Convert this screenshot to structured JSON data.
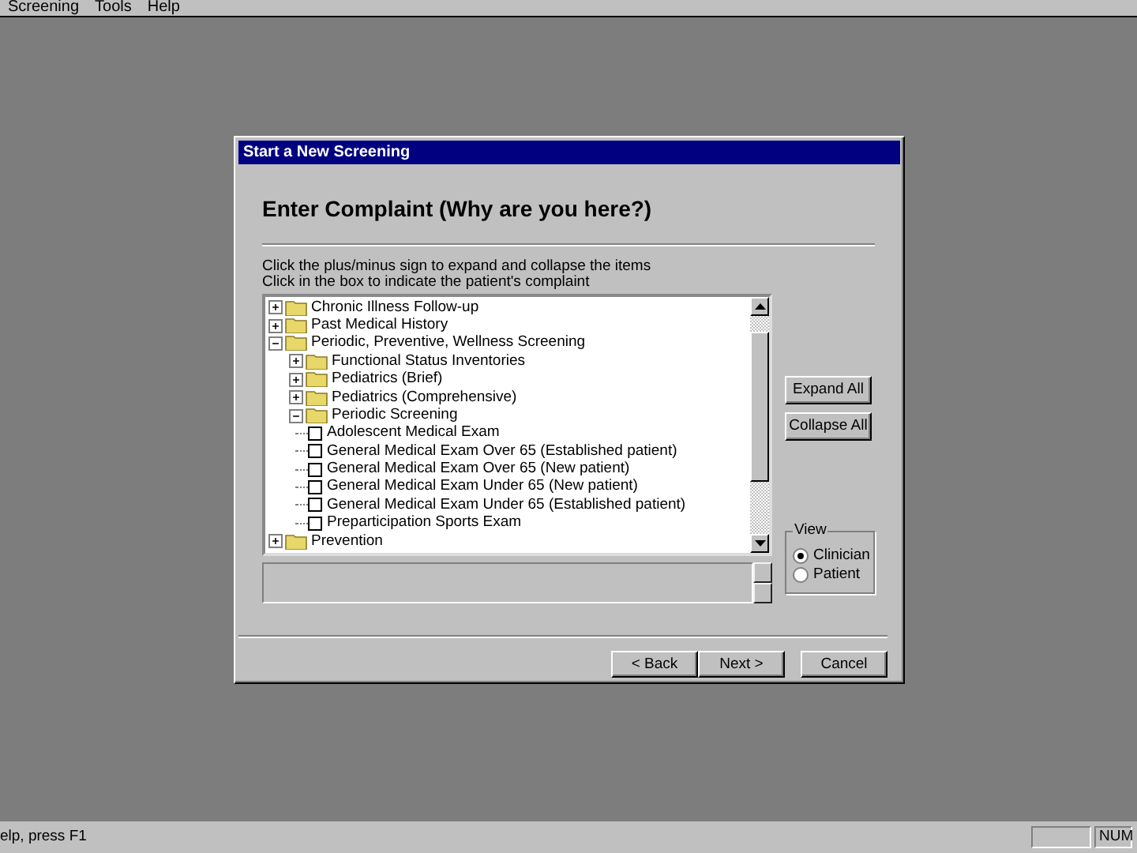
{
  "menu": [
    {
      "label": "Screening"
    },
    {
      "label": "Tools"
    },
    {
      "label": "Help"
    }
  ],
  "dialog": {
    "title": "Start a New Screening",
    "heading": "Enter Complaint (Why are you here?)",
    "instructions": [
      "Click the plus/minus sign to expand and collapse the items",
      "Click in the box to indicate the patient's complaint"
    ],
    "tree": [
      {
        "kind": "folder",
        "label": "Chronic Illness Follow-up",
        "expanded": false
      },
      {
        "kind": "folder",
        "label": "Past Medical History",
        "expanded": false
      },
      {
        "kind": "folder",
        "label": "Periodic, Preventive, Wellness Screening",
        "expanded": true,
        "children": [
          {
            "kind": "folder",
            "label": "Functional Status Inventories",
            "expanded": false
          },
          {
            "kind": "folder",
            "label": "Pediatrics (Brief)",
            "expanded": false
          },
          {
            "kind": "folder",
            "label": "Pediatrics (Comprehensive)",
            "expanded": false
          },
          {
            "kind": "folder",
            "label": "Periodic Screening",
            "expanded": true,
            "children": [
              {
                "kind": "item",
                "label": "Adolescent Medical Exam",
                "checked": false
              },
              {
                "kind": "item",
                "label": "General Medical Exam Over 65 (Established patient)",
                "checked": false
              },
              {
                "kind": "item",
                "label": "General Medical Exam Over 65 (New patient)",
                "checked": false
              },
              {
                "kind": "item",
                "label": "General Medical Exam Under 65 (New patient)",
                "checked": false
              },
              {
                "kind": "item",
                "label": "General Medical Exam Under 65 (Established patient)",
                "checked": false
              },
              {
                "kind": "item",
                "label": "Preparticipation Sports Exam",
                "checked": false
              }
            ]
          }
        ]
      },
      {
        "kind": "folder",
        "label": "Prevention",
        "expanded": false
      }
    ],
    "side_buttons": [
      {
        "label": "Expand All"
      },
      {
        "label": "Collapse All"
      }
    ],
    "view": {
      "label": "View",
      "options": [
        {
          "label": "Clinician",
          "selected": true
        },
        {
          "label": "Patient",
          "selected": false
        }
      ]
    },
    "buttons": [
      {
        "label": "< Back"
      },
      {
        "label": "Next >"
      },
      {
        "label": "Cancel"
      }
    ]
  },
  "status_bar": {
    "text": "elp, press F1",
    "panes": [
      {
        "kind": "blank"
      },
      {
        "kind": "text",
        "text": "NUM"
      }
    ]
  }
}
